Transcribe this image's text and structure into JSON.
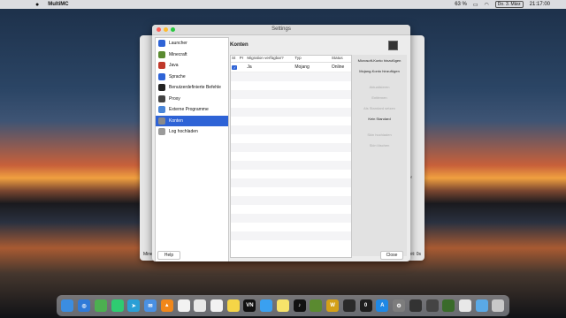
{
  "menubar": {
    "app_name": "MultiMC",
    "battery": "63 %",
    "date": "Do. 3. März",
    "time": "21:17:00"
  },
  "background_window": {
    "right_strip": [
      "sion",
      "",
      "",
      "eln",
      "den",
      "eitern",
      "en",
      "en",
      "iner",
      "Ordner",
      "ner",
      "",
      "",
      "",
      "",
      "hnen"
    ],
    "bottom_left": "Mine",
    "bottom_right": "eit: 0s"
  },
  "settings": {
    "title": "Settings",
    "nav": [
      {
        "label": "Launcher",
        "icon": "rocket-icon",
        "color": "#2e63d6"
      },
      {
        "label": "Minecraft",
        "icon": "grass-block-icon",
        "color": "#5a8a30"
      },
      {
        "label": "Java",
        "icon": "java-icon",
        "color": "#c0392b"
      },
      {
        "label": "Sprache",
        "icon": "language-icon",
        "color": "#2e63d6"
      },
      {
        "label": "Benutzerdefinierte Befehle",
        "icon": "terminal-icon",
        "color": "#222222"
      },
      {
        "label": "Proxy",
        "icon": "proxy-icon",
        "color": "#444444"
      },
      {
        "label": "Externe Programme",
        "icon": "gear-icon",
        "color": "#4a86d8"
      },
      {
        "label": "Konten",
        "icon": "accounts-icon",
        "color": "#8a8a8a"
      },
      {
        "label": "Log hochladen",
        "icon": "document-icon",
        "color": "#9a9a9a"
      }
    ],
    "active_nav": 7,
    "page_title": "Konten",
    "table": {
      "headers": [
        "St",
        "Pr",
        "Migration verfügbar?",
        "Typ",
        "Status"
      ],
      "rows": [
        {
          "default": true,
          "profile": "",
          "migration": "Ja",
          "type": "Mojang",
          "status": "Online"
        }
      ]
    },
    "actions": [
      {
        "label": "Microsoft-Konto hinzufügen",
        "enabled": true
      },
      {
        "label": "Mojang-Konto hinzufügen",
        "enabled": true
      },
      {
        "label": "Aktualisieren",
        "enabled": false
      },
      {
        "label": "Entfernen",
        "enabled": false
      },
      {
        "label": "Als Standard setzen",
        "enabled": false
      },
      {
        "label": "Kein Standard",
        "enabled": true
      },
      {
        "label": "Skin hochladen",
        "enabled": false
      },
      {
        "label": "Skin löschen",
        "enabled": false
      }
    ],
    "help_label": "Help",
    "close_label": "Close"
  },
  "dock": [
    {
      "name": "finder-icon",
      "color": "#3b8de0",
      "glyph": ""
    },
    {
      "name": "safari-icon",
      "color": "#2f7ad8",
      "glyph": "◎"
    },
    {
      "name": "maps-icon",
      "color": "#4caf50",
      "glyph": ""
    },
    {
      "name": "messages-icon",
      "color": "#2ecc71",
      "glyph": ""
    },
    {
      "name": "telegram-icon",
      "color": "#2a9fd6",
      "glyph": "➤"
    },
    {
      "name": "mail-icon",
      "color": "#4a90e2",
      "glyph": "✉"
    },
    {
      "name": "vlc-icon",
      "color": "#f0871a",
      "glyph": "▲"
    },
    {
      "name": "music-icon",
      "color": "#f2f2f2",
      "glyph": ""
    },
    {
      "name": "reader-icon",
      "color": "#e8e8e8",
      "glyph": ""
    },
    {
      "name": "photos-icon",
      "color": "#f2f2f2",
      "glyph": ""
    },
    {
      "name": "notes-icon",
      "color": "#f5d547",
      "glyph": ""
    },
    {
      "name": "vn-icon",
      "color": "#111111",
      "glyph": "VN"
    },
    {
      "name": "clips-icon",
      "color": "#3aa0f0",
      "glyph": ""
    },
    {
      "name": "stickies-icon",
      "color": "#f7e36a",
      "glyph": ""
    },
    {
      "name": "tiktok-icon",
      "color": "#111111",
      "glyph": "♪"
    },
    {
      "name": "minecraft-icon",
      "color": "#5a8a30",
      "glyph": ""
    },
    {
      "name": "wow-icon",
      "color": "#d4a017",
      "glyph": "W"
    },
    {
      "name": "app-icon",
      "color": "#2a2a2a",
      "glyph": ""
    },
    {
      "name": "obs-icon",
      "color": "#1e1e1e",
      "glyph": "0"
    },
    {
      "name": "app-store-icon",
      "color": "#1e88e5",
      "glyph": "A"
    },
    {
      "name": "settings-icon",
      "color": "#7d7d7d",
      "glyph": "⚙"
    },
    {
      "name": "activity-icon",
      "color": "#333333",
      "glyph": ""
    },
    {
      "name": "screenshot-icon",
      "color": "#444444",
      "glyph": ""
    },
    {
      "name": "multimc-icon",
      "color": "#3a6b2a",
      "glyph": ""
    },
    {
      "name": "preview-icon",
      "color": "#e8e8e8",
      "glyph": ""
    },
    {
      "name": "folder-icon",
      "color": "#5aa9e6",
      "glyph": ""
    },
    {
      "name": "trash-icon",
      "color": "#c8c8c8",
      "glyph": ""
    }
  ]
}
